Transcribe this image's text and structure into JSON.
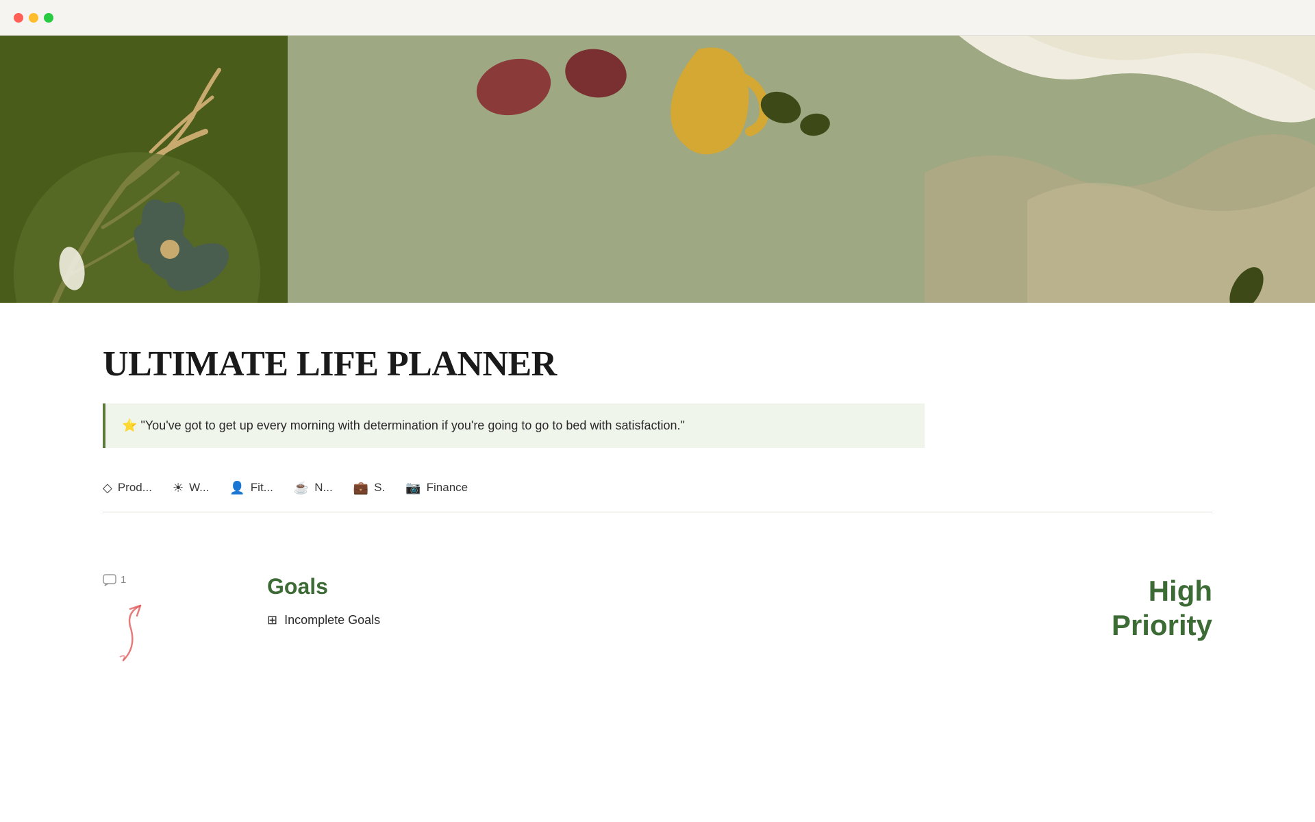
{
  "window": {
    "traffic_lights": {
      "close_color": "#ff5f57",
      "minimize_color": "#ffbd2e",
      "maximize_color": "#28ca41"
    }
  },
  "hero": {
    "bg_left_color": "#4a5c1a",
    "bg_right_color": "#9ea882",
    "bg_far_right": "#f0ede0"
  },
  "page": {
    "title": "ULTIMATE LIFE PLANNER",
    "quote_icon": "⭐",
    "quote_text": "\"You've got to get up every morning with determination if you're going to go to bed with satisfaction.\""
  },
  "nav_tabs": [
    {
      "icon": "◇",
      "label": "Prod..."
    },
    {
      "icon": "☀",
      "label": "W..."
    },
    {
      "icon": "👤",
      "label": "Fit..."
    },
    {
      "icon": "☕",
      "label": "N..."
    },
    {
      "icon": "💼",
      "label": "S."
    },
    {
      "icon": "📷",
      "label": "Finance"
    }
  ],
  "bottom": {
    "comment_count": "1",
    "goals_title": "Goals",
    "goals_items": [
      {
        "icon": "⊞",
        "label": "Incomplete Goals"
      }
    ],
    "priority_label": "High\nPriority"
  },
  "colors": {
    "green_accent": "#3d6b35",
    "light_quote_bg": "#f0f5ec",
    "quote_border": "#5c7a3e"
  }
}
